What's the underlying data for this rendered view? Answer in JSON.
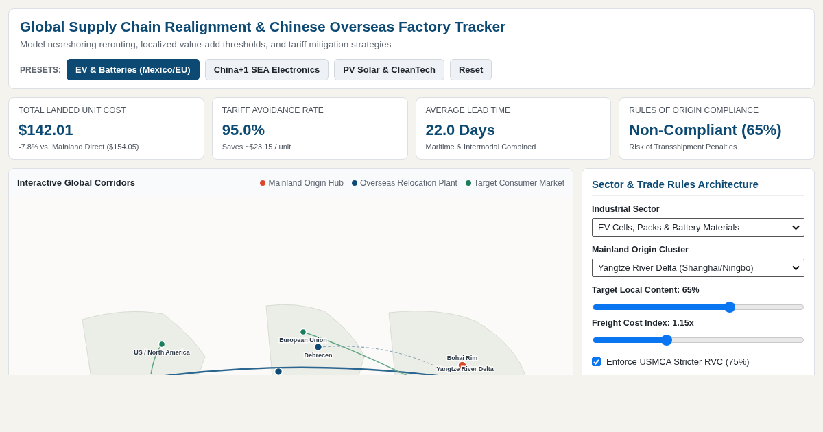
{
  "header": {
    "title": "Global Supply Chain Realignment & Chinese Overseas Factory Tracker",
    "subtitle": "Model nearshoring rerouting, localized value-add thresholds, and tariff mitigation strategies",
    "presets_label": "PRESETS:",
    "presets": [
      {
        "label": "EV & Batteries (Mexico/EU)",
        "selected": true
      },
      {
        "label": "China+1 SEA Electronics",
        "selected": false
      },
      {
        "label": "PV Solar & CleanTech",
        "selected": false
      },
      {
        "label": "Reset",
        "selected": false
      }
    ]
  },
  "kpis": [
    {
      "label": "TOTAL LANDED UNIT COST",
      "value": "$142.01",
      "note": "-7.8% vs. Mainland Direct ($154.05)"
    },
    {
      "label": "TARIFF AVOIDANCE RATE",
      "value": "95.0%",
      "note": "Saves ~$23.15 / unit"
    },
    {
      "label": "AVERAGE LEAD TIME",
      "value": "22.0 Days",
      "note": "Maritime & Intermodal Combined"
    },
    {
      "label": "RULES OF ORIGIN COMPLIANCE",
      "value": "Non-Compliant (65%)",
      "note": "Risk of Transshipment Penalties"
    }
  ],
  "map": {
    "title": "Interactive Global Corridors",
    "legend": [
      {
        "label": "Mainland Origin Hub",
        "color": "#d9482b"
      },
      {
        "label": "Overseas Relocation Plant",
        "color": "#0d4a73"
      },
      {
        "label": "Target Consumer Market",
        "color": "#1b7d5a"
      }
    ],
    "nodes": [
      {
        "label": "US / North America",
        "kind": "market"
      },
      {
        "label": "European Union",
        "kind": "market"
      },
      {
        "label": "Debrecen",
        "kind": "plant"
      },
      {
        "kind": "plant"
      },
      {
        "label": "Bohai Rim",
        "kind": "origin"
      },
      {
        "label": "Yangtze River Delta",
        "kind": "label"
      }
    ]
  },
  "panel": {
    "title": "Sector & Trade Rules Architecture",
    "sector": {
      "label": "Industrial Sector",
      "value": "EV Cells, Packs & Battery Materials"
    },
    "cluster": {
      "label": "Mainland Origin Cluster",
      "value": "Yangtze River Delta (Shanghai/Ningbo)"
    },
    "sliders": [
      {
        "label": "Target Local Content: 65%",
        "level": 0.65
      },
      {
        "label": "Freight Cost Index: 1.15x",
        "level": 0.35
      }
    ],
    "checkbox": {
      "label": "Enforce USMCA Stricter RVC (75%)",
      "checked": true
    }
  }
}
